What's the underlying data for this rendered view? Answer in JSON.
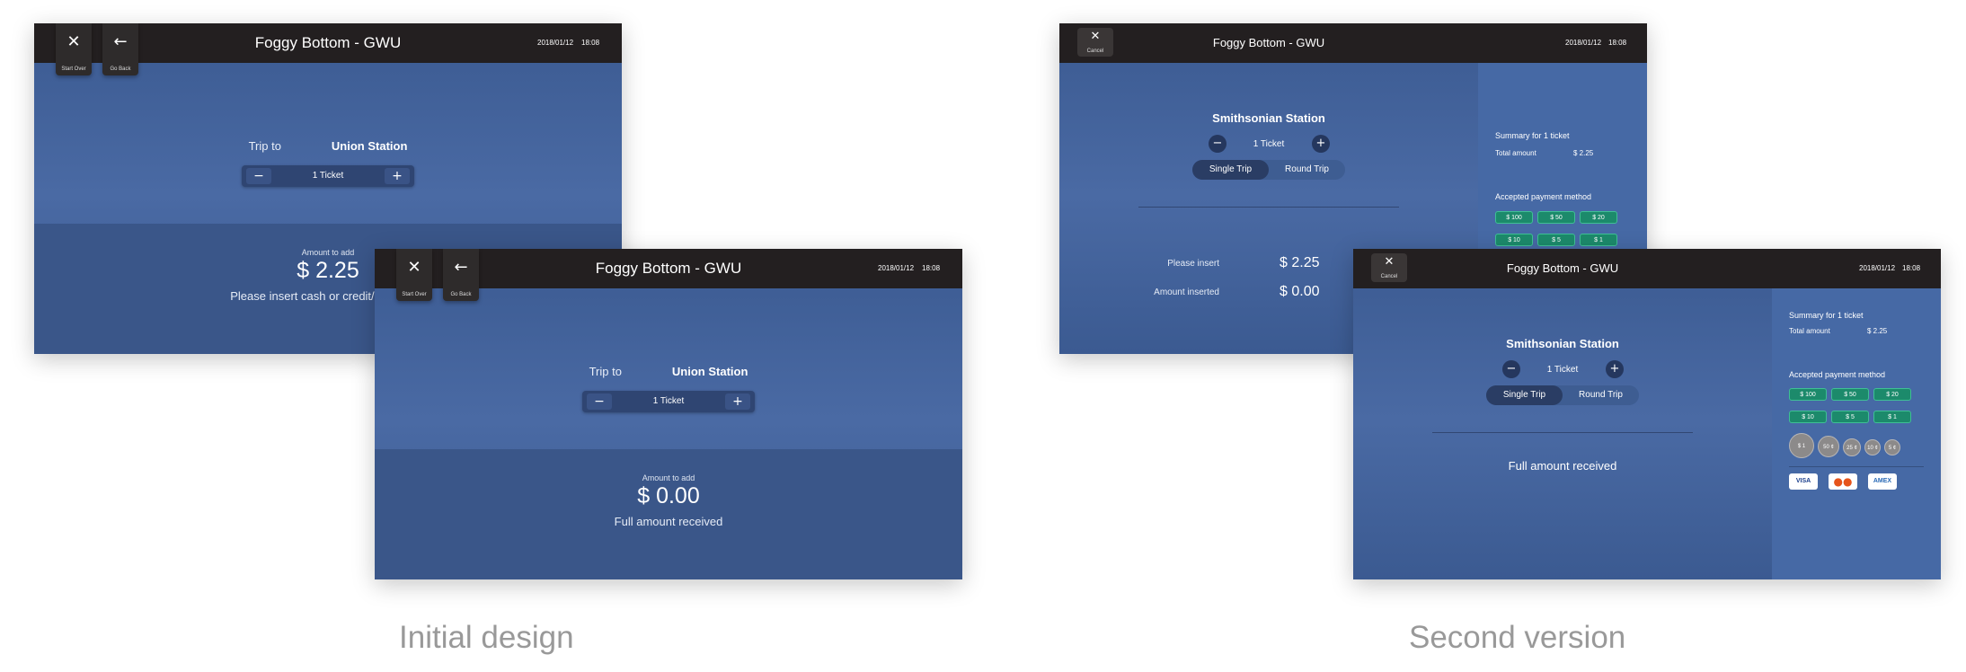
{
  "initial_design": {
    "caption": "Initial design",
    "common": {
      "station_title": "Foggy Bottom - GWU",
      "date": "2018/01/12",
      "time": "18:08",
      "start_over_label": "Start Over",
      "go_back_label": "Go Back",
      "trip_label": "Trip to",
      "destination": "Union Station",
      "quantity": "1 Ticket",
      "amount_label": "Amount to add"
    },
    "screen_back": {
      "amount": "$ 2.25",
      "message": "Please insert cash or credit/debit card"
    },
    "screen_front": {
      "amount": "$ 0.00",
      "message": "Full amount received"
    }
  },
  "second_version": {
    "caption": "Second version",
    "common": {
      "station_title": "Foggy Bottom - GWU",
      "date": "2018/01/12",
      "time": "18:08",
      "cancel_label": "Cancel",
      "destination": "Smithsonian Station",
      "quantity": "1 Ticket",
      "single_trip": "Single Trip",
      "round_trip": "Round Trip",
      "summary_title": "Summary for 1 ticket",
      "total_label": "Total amount",
      "total_value": "$ 2.25",
      "payment_title": "Accepted payment method",
      "notes": [
        "$ 100",
        "$ 50",
        "$ 20",
        "$ 10",
        "$ 5",
        "$ 1"
      ],
      "coins": [
        "$ 1",
        "50 ¢",
        "25 ¢",
        "10 ¢",
        "5 ¢"
      ],
      "cards": [
        "VISA",
        "AMEX"
      ]
    },
    "screen_back": {
      "please_insert_label": "Please insert",
      "please_insert_value": "$ 2.25",
      "amount_inserted_label": "Amount inserted",
      "amount_inserted_value": "$ 0.00"
    },
    "screen_front": {
      "message": "Full amount received"
    }
  }
}
